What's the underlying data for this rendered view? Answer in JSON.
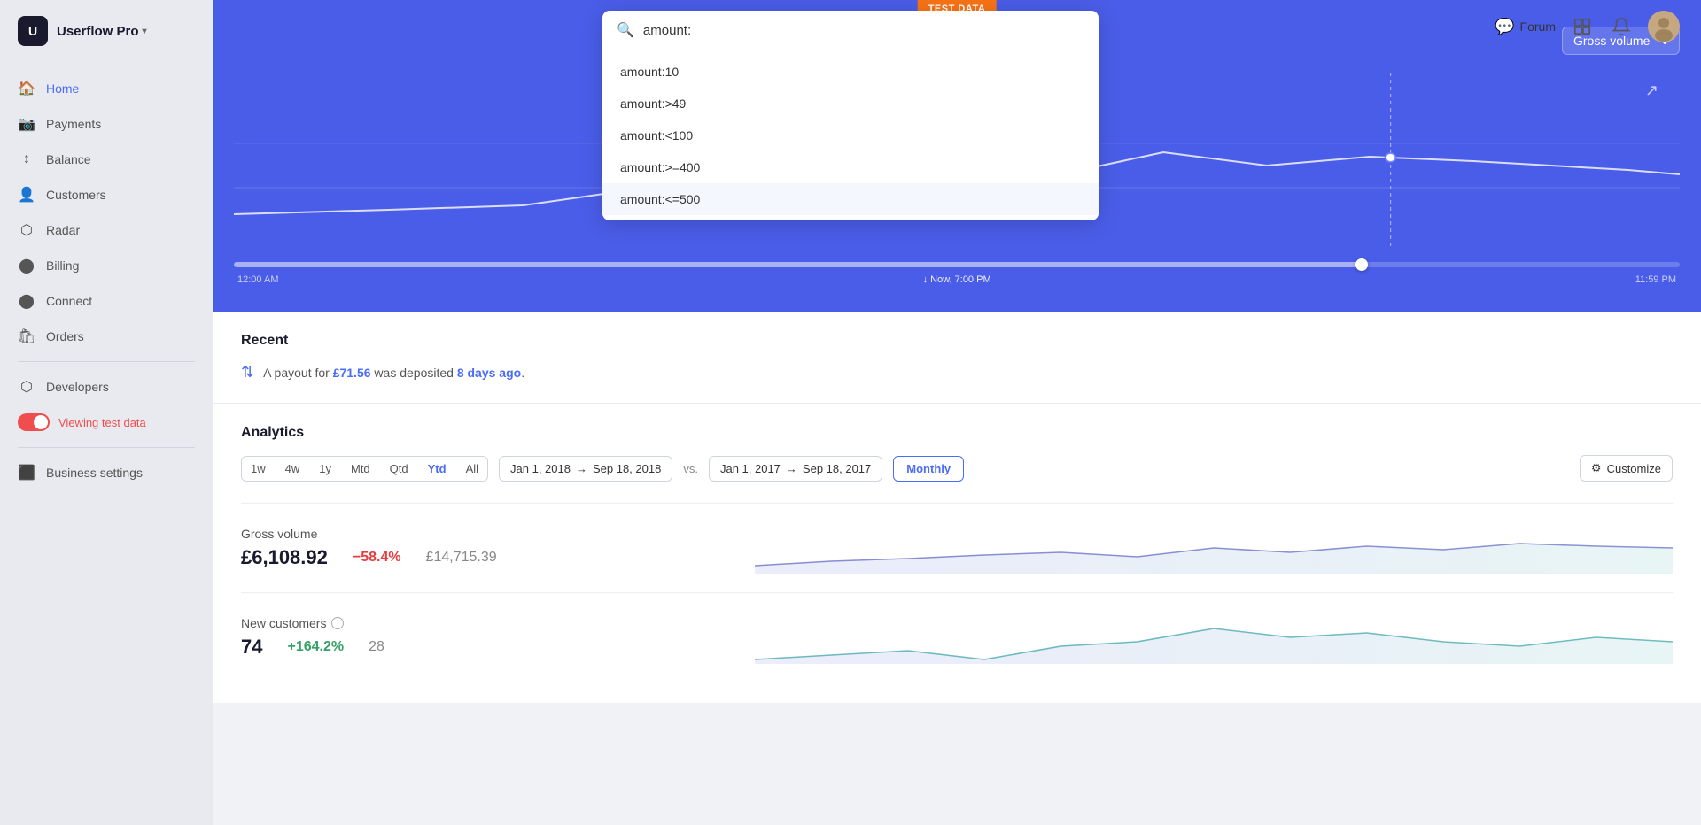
{
  "app": {
    "name": "Userflow Pro",
    "logo_letter": "U"
  },
  "sidebar": {
    "nav_items": [
      {
        "id": "home",
        "label": "Home",
        "icon": "🏠",
        "active": true
      },
      {
        "id": "payments",
        "label": "Payments",
        "icon": "📷",
        "active": false
      },
      {
        "id": "balance",
        "label": "Balance",
        "icon": "↕",
        "active": false
      },
      {
        "id": "customers",
        "label": "Customers",
        "icon": "👤",
        "active": false
      },
      {
        "id": "radar",
        "label": "Radar",
        "icon": "⬡",
        "active": false
      },
      {
        "id": "billing",
        "label": "Billing",
        "icon": "⬤",
        "active": false
      },
      {
        "id": "connect",
        "label": "Connect",
        "icon": "⬤",
        "active": false
      },
      {
        "id": "orders",
        "label": "Orders",
        "icon": "🛍",
        "active": false
      }
    ],
    "developers_label": "Developers",
    "viewing_test_data": "Viewing test data",
    "business_settings": "Business settings"
  },
  "topbar": {
    "forum_label": "Forum",
    "chevron_dropdown": "▼"
  },
  "hero": {
    "test_data_badge": "TEST DATA",
    "gross_volume_select": "Gross volume",
    "time_start": "12:00 AM",
    "time_current": "↓ Now, 7:00 PM",
    "time_end": "11:59 PM"
  },
  "recent": {
    "title": "Recent",
    "payout_prefix": "A payout for ",
    "payout_amount": "£71.56",
    "payout_middle": " was deposited ",
    "payout_days": "8 days ago",
    "payout_suffix": "."
  },
  "analytics": {
    "title": "Analytics",
    "presets": [
      "1w",
      "4w",
      "1y",
      "Mtd",
      "Qtd",
      "Ytd",
      "All"
    ],
    "active_preset": "Ytd",
    "date_range_1_start": "Jan 1, 2018",
    "date_range_1_end": "Sep 18, 2018",
    "vs_label": "vs.",
    "date_range_2_start": "Jan 1, 2017",
    "date_range_2_end": "Sep 18, 2017",
    "monthly_label": "Monthly",
    "customize_label": "Customize",
    "metrics": [
      {
        "name": "Gross volume",
        "has_info": false,
        "primary": "£6,108.92",
        "change": "−58.4%",
        "change_type": "negative",
        "secondary": "£14,715.39"
      },
      {
        "name": "New customers",
        "has_info": true,
        "primary": "74",
        "change": "+164.2%",
        "change_type": "positive",
        "secondary": "28"
      }
    ]
  },
  "search": {
    "placeholder": "amount:",
    "input_value": "amount:",
    "suggestions": [
      "amount:10",
      "amount:>49",
      "amount:<100",
      "amount:>=400",
      "amount:<=500"
    ],
    "hovered_index": 4
  }
}
